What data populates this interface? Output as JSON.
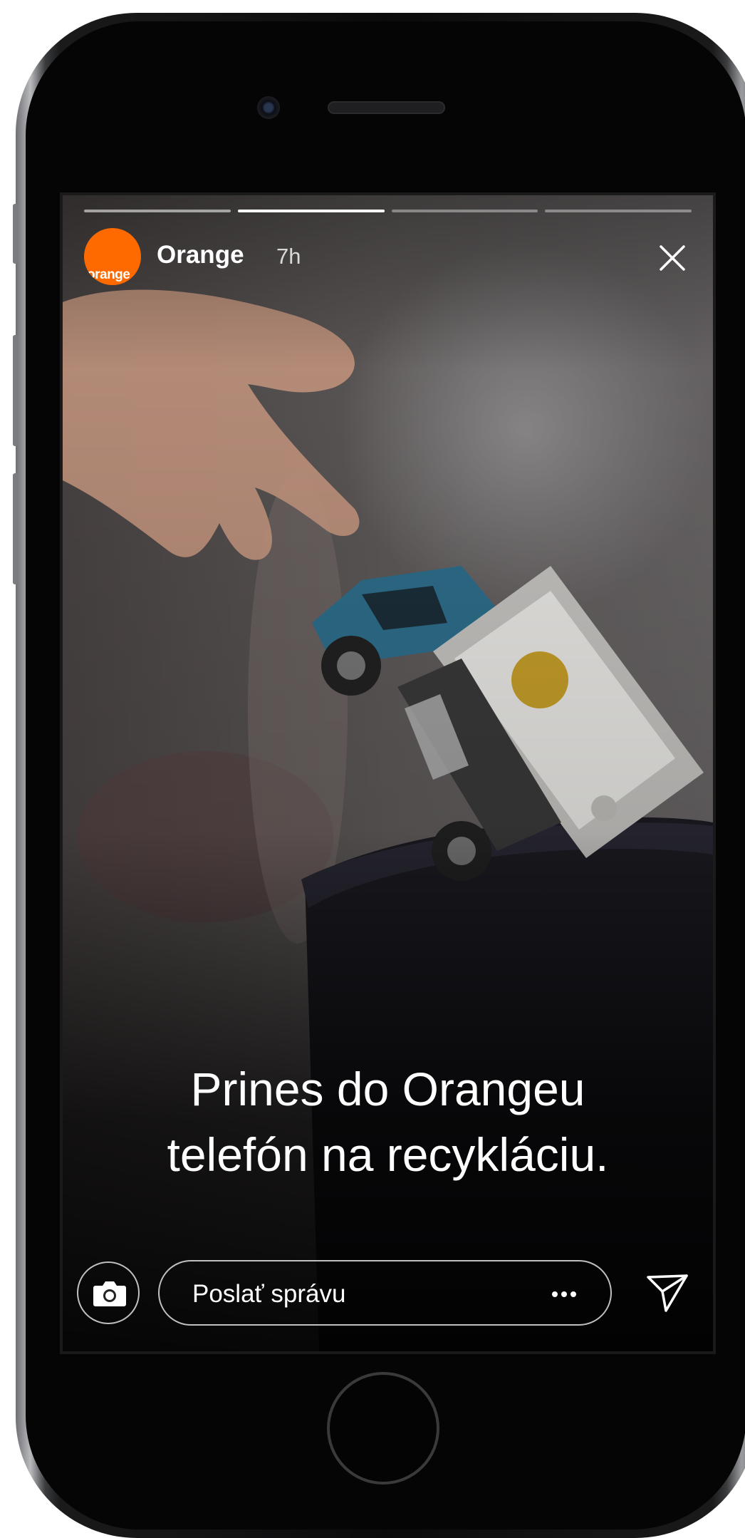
{
  "story": {
    "account_name": "Orange",
    "time_ago": "7h",
    "avatar_text": "orange",
    "progress_segments": 4,
    "active_segment": 2,
    "caption_line1": "Prines do Orangeu",
    "caption_line2": "telefón na recykláciu.",
    "image_description_icons": [
      "hand",
      "toy-truck",
      "trash-bin"
    ]
  },
  "composer": {
    "placeholder": "Poslať správu"
  },
  "icons": {
    "close": "close-icon",
    "camera": "camera-icon",
    "more": "more-dots-icon",
    "send": "send-icon"
  },
  "colors": {
    "brand": "#ff6a00",
    "text": "#ffffff"
  }
}
